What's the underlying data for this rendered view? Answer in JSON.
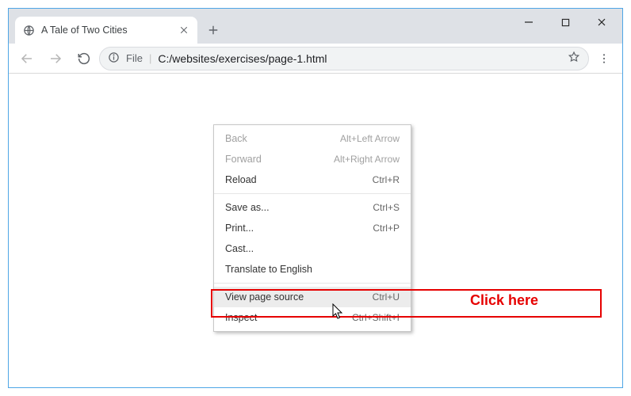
{
  "tab": {
    "title": "A Tale of Two Cities"
  },
  "omnibox": {
    "label": "File",
    "url": "C:/websites/exercises/page-1.html"
  },
  "menu": {
    "items": [
      {
        "label": "Back",
        "shortcut": "Alt+Left Arrow",
        "disabled": true
      },
      {
        "label": "Forward",
        "shortcut": "Alt+Right Arrow",
        "disabled": true
      },
      {
        "label": "Reload",
        "shortcut": "Ctrl+R"
      }
    ],
    "items2": [
      {
        "label": "Save as...",
        "shortcut": "Ctrl+S"
      },
      {
        "label": "Print...",
        "shortcut": "Ctrl+P"
      },
      {
        "label": "Cast...",
        "shortcut": ""
      },
      {
        "label": "Translate to English",
        "shortcut": ""
      }
    ],
    "items3": [
      {
        "label": "View page source",
        "shortcut": "Ctrl+U",
        "hover": true
      },
      {
        "label": "Inspect",
        "shortcut": "Ctrl+Shift+I"
      }
    ]
  },
  "callout": {
    "text": "Click here"
  }
}
